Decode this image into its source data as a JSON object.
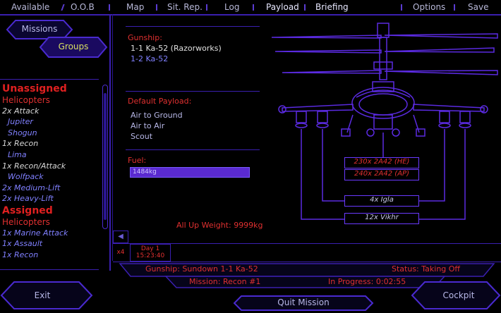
{
  "top_tabs": {
    "available": "Available",
    "oob": "O.O.B",
    "map": "Map",
    "sit_rep": "Sit. Rep.",
    "log": "Log",
    "payload": "Payload",
    "briefing": "Briefing",
    "options": "Options",
    "save": "Save"
  },
  "left_panel": {
    "missions_button": "Missions",
    "groups_button": "Groups",
    "list": [
      {
        "text": "Unassigned",
        "style": "red-h"
      },
      {
        "text": "Helicopters",
        "style": "red-s"
      },
      {
        "text": "2x Attack",
        "style": "white-i"
      },
      {
        "text": "Jupiter",
        "style": "blue-i"
      },
      {
        "text": "Shogun",
        "style": "blue-i"
      },
      {
        "text": "1x Recon",
        "style": "white-i"
      },
      {
        "text": "Lima",
        "style": "blue-i"
      },
      {
        "text": "1x Recon/Attack",
        "style": "white-i"
      },
      {
        "text": "Wolfpack",
        "style": "blue-i"
      },
      {
        "text": "2x Medium-Lift",
        "style": "blue-i"
      },
      {
        "text": "2x Heavy-Lift",
        "style": "blue-i"
      },
      {
        "text": "Assigned",
        "style": "red-h"
      },
      {
        "text": "Helicopters",
        "style": "red-s"
      },
      {
        "text": "1x Marine Attack",
        "style": "blue-i"
      },
      {
        "text": "1x Assault",
        "style": "blue-i"
      },
      {
        "text": "1x Recon",
        "style": "blue-i"
      }
    ]
  },
  "payload_panel": {
    "gunship_label": "Gunship:",
    "gunships": [
      "1-1 Ka-52 (Razorworks)",
      "1-2 Ka-52"
    ],
    "default_payload_label": "Default Payload:",
    "payloads": [
      "Air to Ground",
      "Air to Air",
      "Scout"
    ],
    "fuel_label": "Fuel:",
    "fuel_value": "1484kg",
    "fuel_fraction": 1.0,
    "weight_label": "All Up Weight: 9999kg"
  },
  "weapons": {
    "he": "230x 2A42 (HE)",
    "ap": "240x 2A42 (AP)",
    "igla": "4x Igla",
    "vikhr": "12x Vikhr"
  },
  "timeline": {
    "speed": "x4",
    "day": "Day 1",
    "time": "15:23:40"
  },
  "status": {
    "gunship": "Gunship: Sundown 1-1 Ka-52",
    "status": "Status: Taking Off",
    "mission": "Mission: Recon #1",
    "progress": "In Progress: 0:02:55"
  },
  "bottom": {
    "exit": "Exit",
    "quit": "Quit Mission",
    "cockpit": "Cockpit"
  },
  "colors": {
    "accent": "#3a1fb0",
    "highlight": "#e03030",
    "link_blue": "#8080ff"
  }
}
